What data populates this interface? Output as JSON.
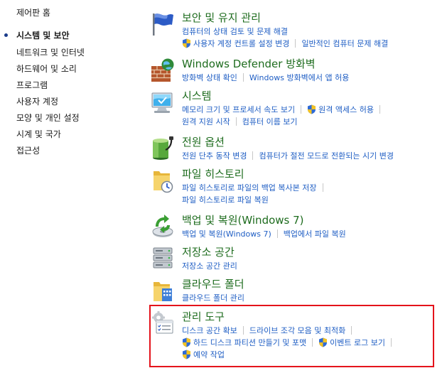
{
  "sidebar": {
    "items": [
      {
        "label": "제어판 홈",
        "current": false
      },
      {
        "label": "시스템 및 보안",
        "current": true
      },
      {
        "label": "네트워크 및 인터넷",
        "current": false
      },
      {
        "label": "하드웨어 및 소리",
        "current": false
      },
      {
        "label": "프로그램",
        "current": false
      },
      {
        "label": "사용자 계정",
        "current": false
      },
      {
        "label": "모양 및 개인 설정",
        "current": false
      },
      {
        "label": "시계 및 국가",
        "current": false
      },
      {
        "label": "접근성",
        "current": false
      }
    ]
  },
  "categories": [
    {
      "title": "보안 및 유지 관리",
      "icon": "flag-icon",
      "rows": [
        [
          {
            "text": "컴퓨터의 상태 검토 및 문제 해결",
            "shield": false
          }
        ],
        [
          {
            "text": "사용자 계정 컨트롤 설정 변경",
            "shield": true
          },
          {
            "text": "일반적인 컴퓨터 문제 해결",
            "shield": false
          }
        ]
      ]
    },
    {
      "title": "Windows Defender 방화벽",
      "icon": "firewall-icon",
      "rows": [
        [
          {
            "text": "방화벽 상태 확인",
            "shield": false
          },
          {
            "text": "Windows 방화벽에서 앱 허용",
            "shield": false
          }
        ]
      ]
    },
    {
      "title": "시스템",
      "icon": "monitor-icon",
      "rows": [
        [
          {
            "text": "메모리 크기 및 프로세서 속도 보기",
            "shield": false
          },
          {
            "text": "원격 액세스 허용",
            "shield": true
          }
        ],
        [
          {
            "text": "원격 지원 시작",
            "shield": false
          },
          {
            "text": "컴퓨터 이름 보기",
            "shield": false
          }
        ]
      ]
    },
    {
      "title": "전원 옵션",
      "icon": "battery-icon",
      "rows": [
        [
          {
            "text": "전원 단추 동작 변경",
            "shield": false
          },
          {
            "text": "컴퓨터가 절전 모드로 전환되는 시기 변경",
            "shield": false
          }
        ]
      ]
    },
    {
      "title": "파일 히스토리",
      "icon": "file-history-icon",
      "rows": [
        [
          {
            "text": "파일 히스토리로 파일의 백업 복사본 저장",
            "shield": false
          }
        ],
        [
          {
            "text": "파일 히스토리로 파일 복원",
            "shield": false
          }
        ]
      ]
    },
    {
      "title": "백업 및 복원(Windows 7)",
      "icon": "backup-icon",
      "rows": [
        [
          {
            "text": "백업 및 복원(Windows 7)",
            "shield": false
          },
          {
            "text": "백업에서 파일 복원",
            "shield": false
          }
        ]
      ]
    },
    {
      "title": "저장소 공간",
      "icon": "storage-icon",
      "rows": [
        [
          {
            "text": "저장소 공간 관리",
            "shield": false
          }
        ]
      ]
    },
    {
      "title": "클라우드 폴더",
      "icon": "cloud-folder-icon",
      "rows": [
        [
          {
            "text": "클라우드 폴더 관리",
            "shield": false
          }
        ]
      ]
    },
    {
      "title": "관리 도구",
      "icon": "admin-tools-icon",
      "rows": [
        [
          {
            "text": "디스크 공간 확보",
            "shield": false
          },
          {
            "text": "드라이브 조각 모음 및 최적화",
            "shield": false
          }
        ],
        [
          {
            "text": "하드 디스크 파티션 만들기 및 포맷",
            "shield": true
          },
          {
            "text": "이벤트 로그 보기",
            "shield": true
          }
        ],
        [
          {
            "text": "예약 작업",
            "shield": true
          }
        ]
      ]
    }
  ],
  "colors": {
    "title": "#1e6c1e",
    "link": "#1f5ec4",
    "highlight": "#e4131b"
  }
}
